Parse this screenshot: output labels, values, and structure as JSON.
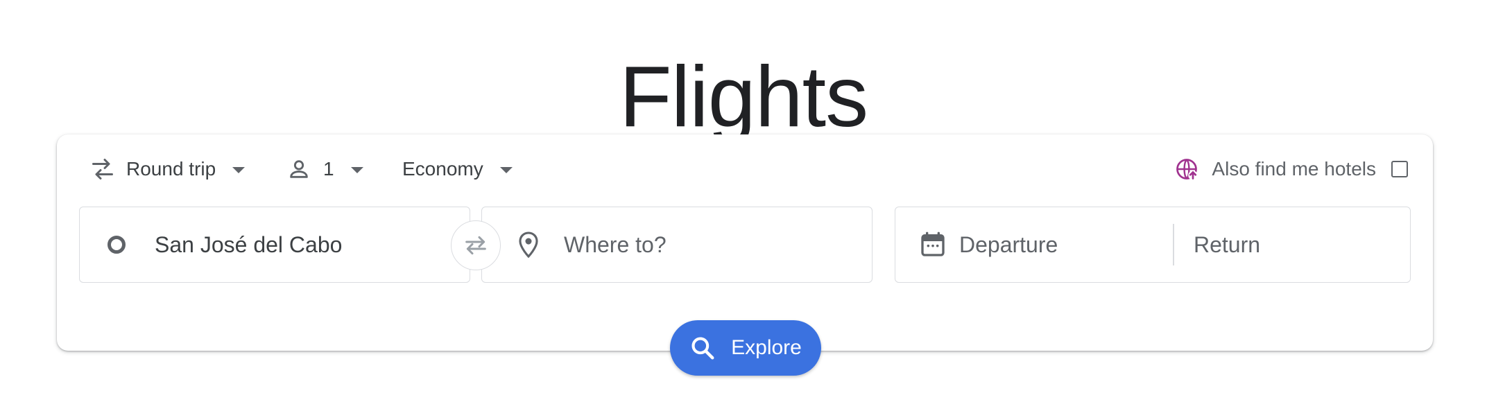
{
  "header": {
    "title": "Flights"
  },
  "search": {
    "trip_type": "Round trip",
    "passengers": "1",
    "cabin_class": "Economy",
    "hotels_label": "Also find me hotels",
    "hotels_checked": false,
    "origin_value": "San José del Cabo",
    "destination_placeholder": "Where to?",
    "departure_placeholder": "Departure",
    "return_placeholder": "Return",
    "explore_label": "Explore"
  },
  "icons": {
    "trip": "swap-arrows-icon",
    "passengers": "person-icon",
    "hotels": "globe-hotel-icon",
    "origin": "origin-circle-icon",
    "swap": "swap-icon",
    "destination": "location-pin-icon",
    "calendar": "calendar-icon",
    "search": "search-icon"
  },
  "colors": {
    "accent": "#3b72e0",
    "hotel_icon": "#a0328f",
    "text": "#3c4043",
    "muted": "#5f6368",
    "border": "#dadce0"
  }
}
